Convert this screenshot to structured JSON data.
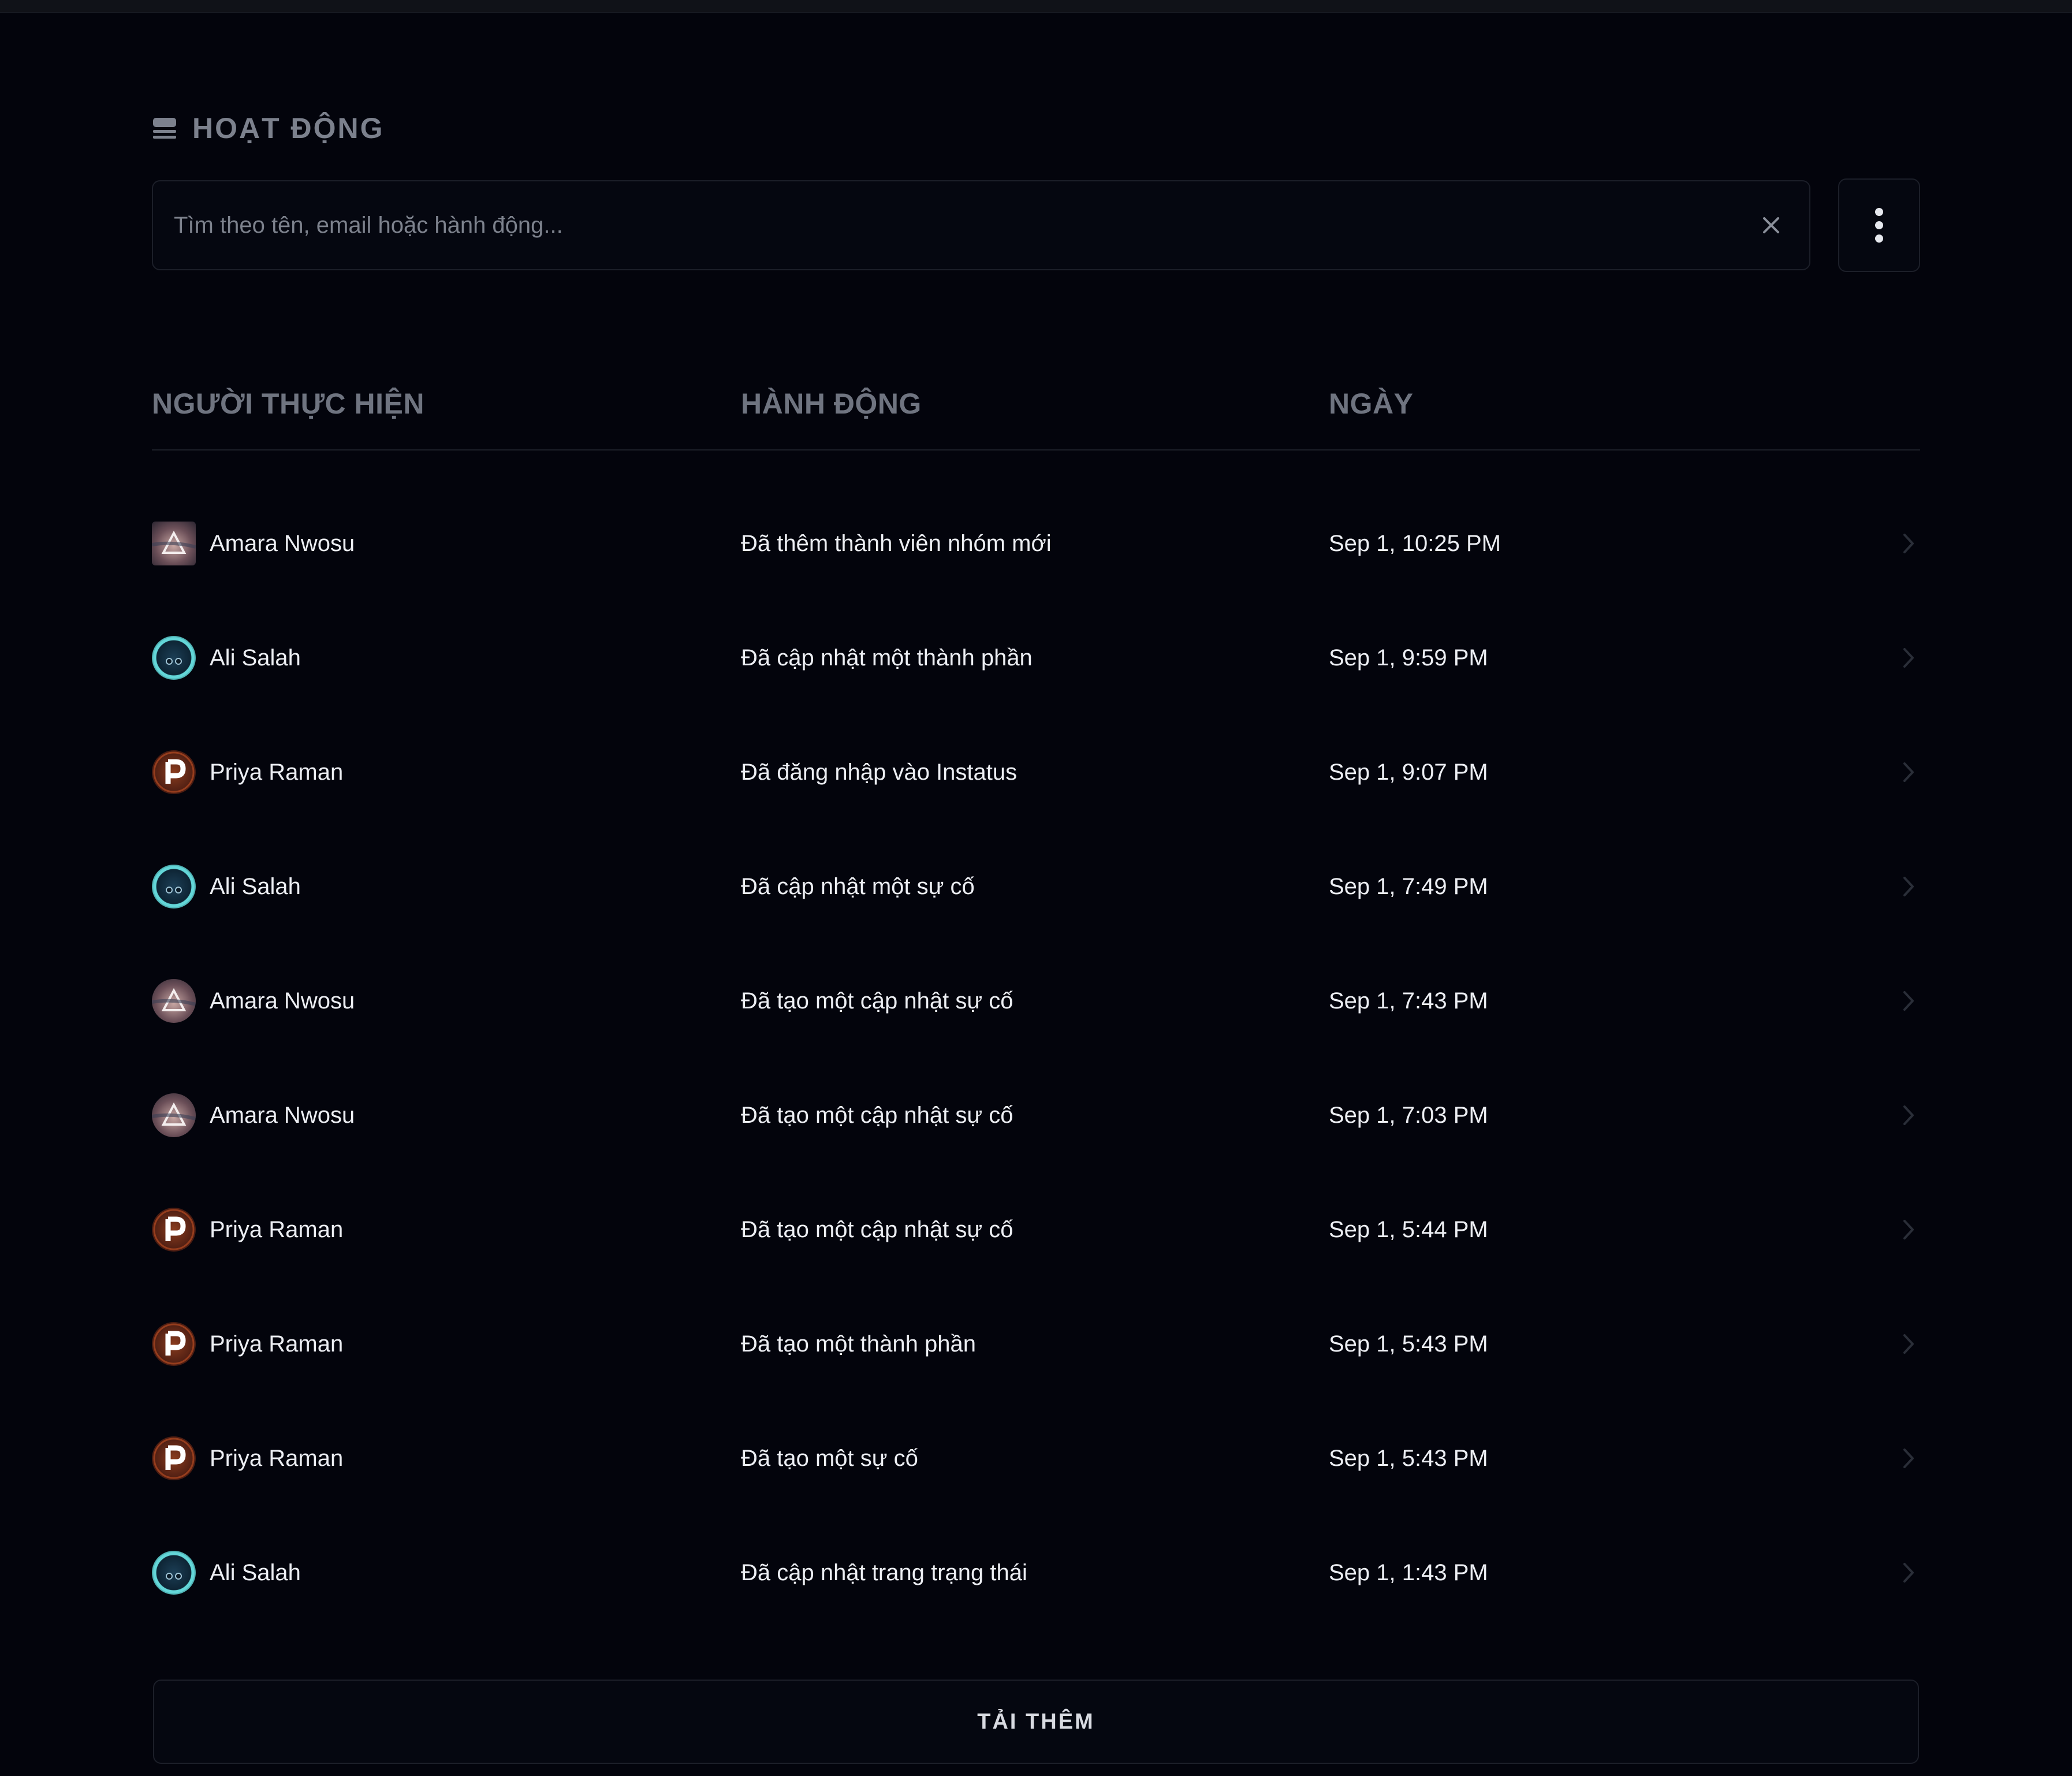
{
  "header": {
    "title": "HOẠT ĐỘNG",
    "icon": "activity-list-icon"
  },
  "search": {
    "placeholder": "Tìm theo tên, email hoặc hành động...",
    "value": ""
  },
  "table": {
    "columns": {
      "user": "NGƯỜI THỰC HIỆN",
      "action": "HÀNH ĐỘNG",
      "date": "NGÀY"
    },
    "rows": [
      {
        "user": "Amara Nwosu",
        "avatar": "amara",
        "action": "Đã thêm thành viên nhóm mới",
        "date": "Sep 1, 10:25 PM"
      },
      {
        "user": "Ali Salah",
        "avatar": "ali",
        "action": "Đã cập nhật một thành phần",
        "date": "Sep 1, 9:59 PM"
      },
      {
        "user": "Priya Raman",
        "avatar": "priya",
        "action": "Đã đăng nhập vào Instatus",
        "date": "Sep 1, 9:07 PM"
      },
      {
        "user": "Ali Salah",
        "avatar": "ali",
        "action": "Đã cập nhật một sự cố",
        "date": "Sep 1, 7:49 PM"
      },
      {
        "user": "Amara Nwosu",
        "avatar": "amara",
        "action": "Đã tạo một cập nhật sự cố",
        "date": "Sep 1, 7:43 PM"
      },
      {
        "user": "Amara Nwosu",
        "avatar": "amara",
        "action": "Đã tạo một cập nhật sự cố",
        "date": "Sep 1, 7:03 PM"
      },
      {
        "user": "Priya Raman",
        "avatar": "priya",
        "action": "Đã tạo một cập nhật sự cố",
        "date": "Sep 1, 5:44 PM"
      },
      {
        "user": "Priya Raman",
        "avatar": "priya",
        "action": "Đã tạo một thành phần",
        "date": "Sep 1, 5:43 PM"
      },
      {
        "user": "Priya Raman",
        "avatar": "priya",
        "action": "Đã tạo một sự cố",
        "date": "Sep 1, 5:43 PM"
      },
      {
        "user": "Ali Salah",
        "avatar": "ali",
        "action": "Đã cập nhật trang trạng thái",
        "date": "Sep 1, 1:43 PM"
      }
    ]
  },
  "load_more": {
    "label": "TẢI THÊM"
  },
  "colors": {
    "background": "#03040c",
    "border": "#1c1f29",
    "muted_text": "#7c818d",
    "text": "#eceef3"
  }
}
